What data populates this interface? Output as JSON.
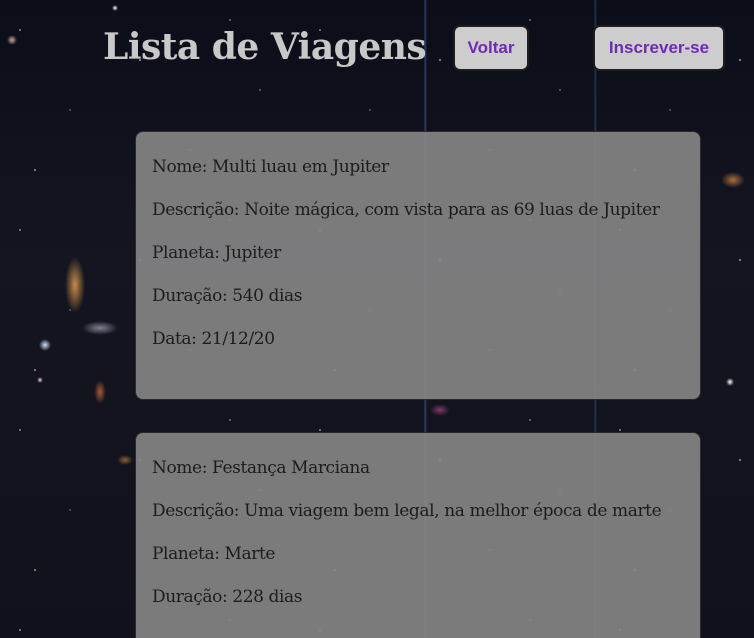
{
  "header": {
    "title": "Lista de Viagens",
    "back_button": "Voltar",
    "subscribe_button": "Inscrever-se"
  },
  "labels": {
    "name": "Nome",
    "description": "Descrição",
    "planet": "Planeta",
    "duration": "Duração",
    "date": "Data"
  },
  "trips": [
    {
      "name": "Multi luau em Jupiter",
      "description": "Noite mágica, com vista para as 69 luas de Jupiter",
      "planet": "Jupiter",
      "duration": "540 dias",
      "date": "21/12/20"
    },
    {
      "name": "Festança Marciana",
      "description": "Uma viagem bem legal, na melhor época de marte",
      "planet": "Marte",
      "duration": "228 dias"
    }
  ],
  "colors": {
    "button_text": "#6d2bb5",
    "card_background": "#8a8a8a",
    "title_text": "#c8c8c8"
  }
}
